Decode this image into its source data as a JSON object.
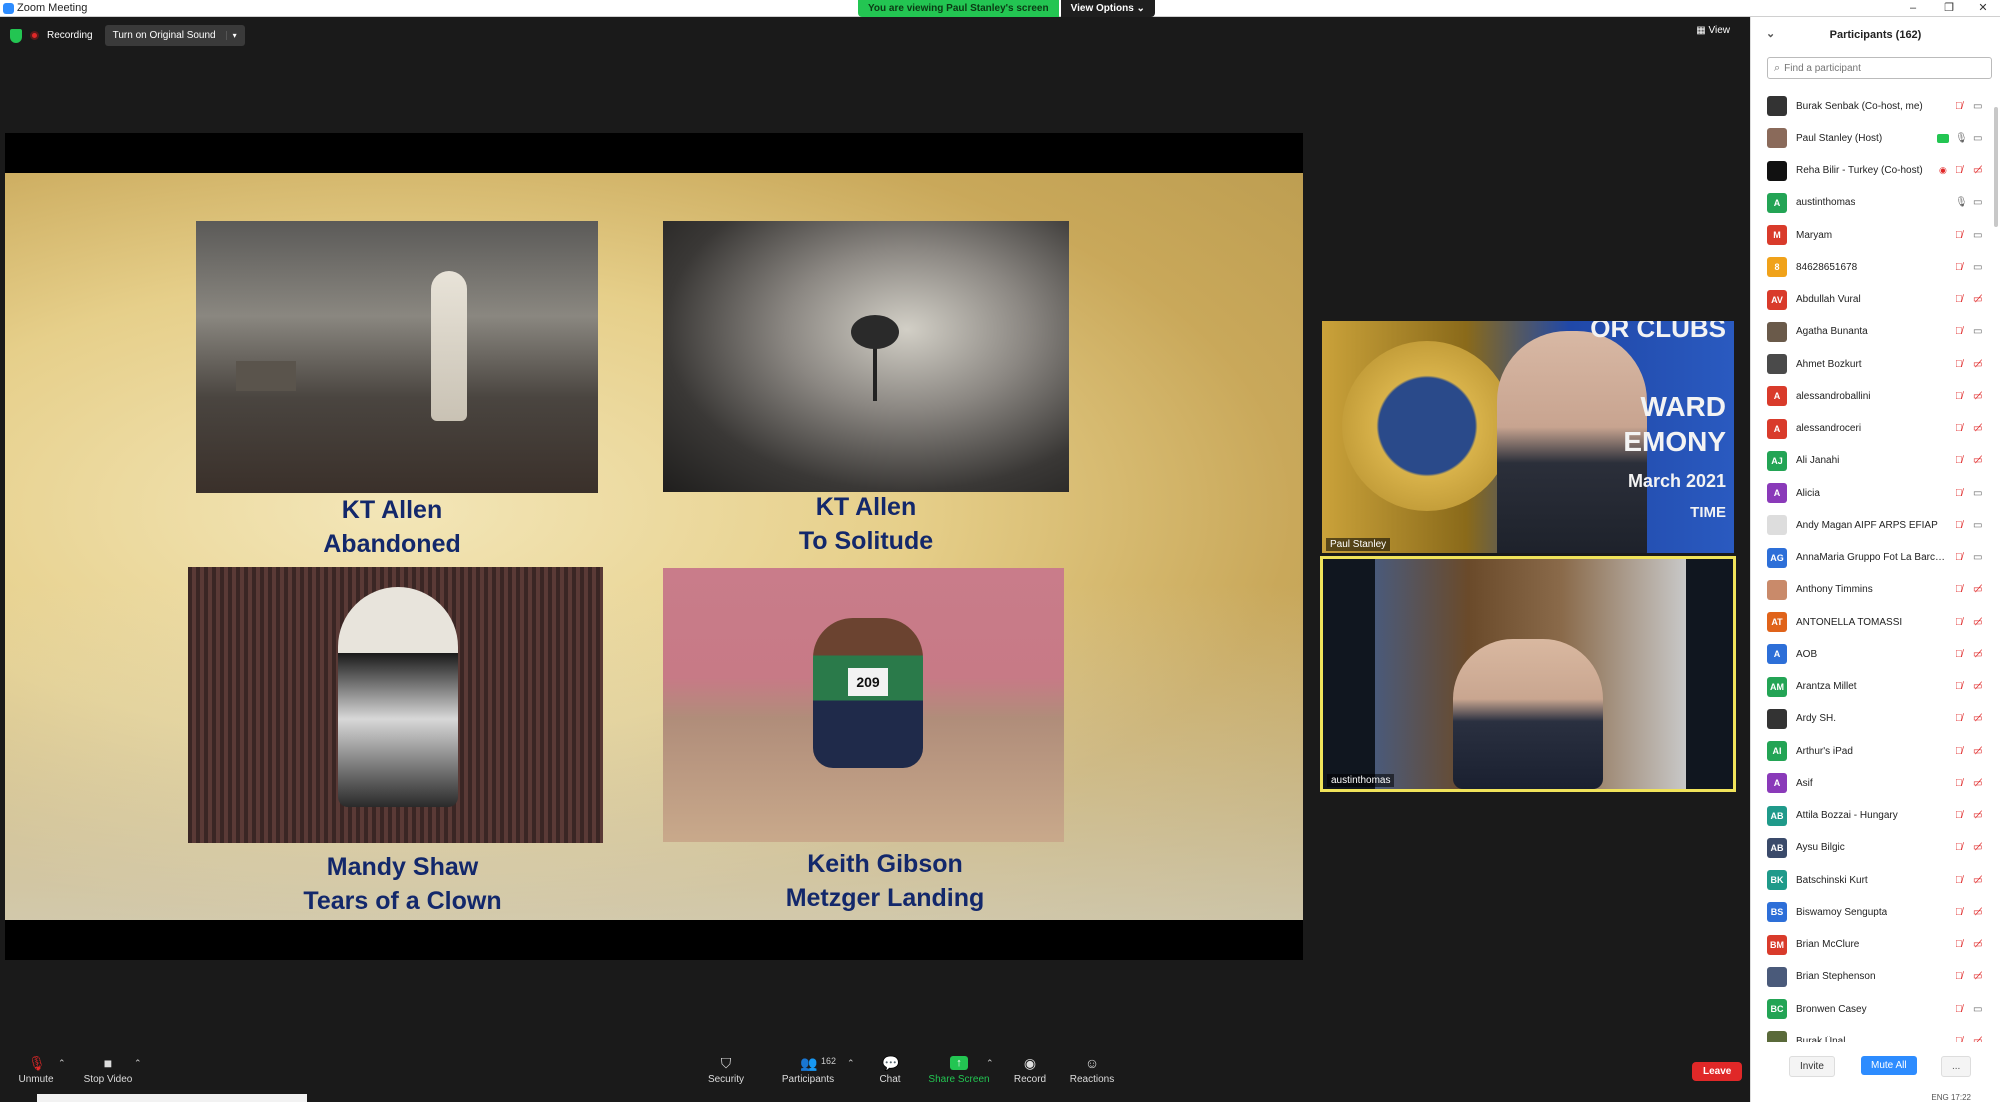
{
  "window": {
    "title": "Zoom Meeting",
    "minimize": "–",
    "restore": "❐",
    "close": "✕"
  },
  "banner": {
    "viewing": "You are viewing Paul Stanley's screen",
    "view_options": "View Options ⌄"
  },
  "topbar": {
    "recording": "Recording",
    "original_sound": "Turn on Original Sound",
    "caret": "▾",
    "view": "▦ View"
  },
  "slide": {
    "captions": [
      {
        "line1": "KT Allen",
        "line2": "Abandoned"
      },
      {
        "line1": "KT Allen",
        "line2": "To Solitude"
      },
      {
        "line1": "Mandy Shaw",
        "line2": "Tears of a Clown"
      },
      {
        "line1": "Keith Gibson",
        "line2": "Metzger Landing"
      }
    ],
    "bib": "209"
  },
  "videos": [
    {
      "name": "Paul Stanley",
      "bg_text": [
        "OR CLUBS",
        "WARD",
        "EMONY",
        "March 2021",
        "TIME"
      ]
    },
    {
      "name": "austinthomas"
    }
  ],
  "toolbar": {
    "unmute": "Unmute",
    "stop_video": "Stop Video",
    "security": "Security",
    "participants": "Participants",
    "participants_count": "162",
    "chat": "Chat",
    "share_screen": "Share Screen",
    "record": "Record",
    "reactions": "Reactions",
    "leave": "Leave"
  },
  "panel": {
    "title": "Participants (162)",
    "search_placeholder": "Find a participant",
    "invite": "Invite",
    "mute_all": "Mute All",
    "more": "...",
    "tray": "ENG 17:22"
  },
  "participants": [
    {
      "initials": "",
      "name": "Burak Senbak (Co-host, me)",
      "color": "#333333",
      "mic": "muted",
      "cam": "on"
    },
    {
      "initials": "",
      "name": "Paul Stanley (Host)",
      "color": "#8a6a5a",
      "mic": "on",
      "cam": "on",
      "sharing": true
    },
    {
      "initials": "",
      "name": "Reha Bilir - Turkey (Co-host)",
      "color": "#111111",
      "mic": "muted",
      "cam": "off",
      "recording": true
    },
    {
      "initials": "A",
      "name": "austinthomas",
      "color": "#23a455",
      "mic": "on",
      "cam": "on"
    },
    {
      "initials": "M",
      "name": "Maryam",
      "color": "#d93b2b",
      "mic": "muted",
      "cam": "on"
    },
    {
      "initials": "8",
      "name": "84628651678",
      "color": "#f0a21a",
      "mic": "muted",
      "cam": "on"
    },
    {
      "initials": "AV",
      "name": "Abdullah Vural",
      "color": "#d93b2b",
      "mic": "muted",
      "cam": "off"
    },
    {
      "initials": "",
      "name": "Agatha Bunanta",
      "color": "#6a5a4a",
      "mic": "muted",
      "cam": "on"
    },
    {
      "initials": "",
      "name": "Ahmet Bozkurt",
      "color": "#4a4a4a",
      "mic": "muted",
      "cam": "off"
    },
    {
      "initials": "A",
      "name": "alessandroballini",
      "color": "#d93b2b",
      "mic": "muted",
      "cam": "off"
    },
    {
      "initials": "A",
      "name": "alessandroceri",
      "color": "#d93b2b",
      "mic": "muted",
      "cam": "off"
    },
    {
      "initials": "AJ",
      "name": "Ali Janahi",
      "color": "#23a455",
      "mic": "muted",
      "cam": "off"
    },
    {
      "initials": "A",
      "name": "Alicia",
      "color": "#8a3ab9",
      "mic": "muted",
      "cam": "on"
    },
    {
      "initials": "",
      "name": "Andy Magan AIPF ARPS EFIAP",
      "color": "#dddddd",
      "mic": "muted",
      "cam": "on"
    },
    {
      "initials": "AG",
      "name": "AnnaMaria Gruppo Fot La Barch...",
      "color": "#2d6fd8",
      "mic": "muted",
      "cam": "on"
    },
    {
      "initials": "",
      "name": "Anthony Timmins",
      "color": "#c98a6a",
      "mic": "muted",
      "cam": "off"
    },
    {
      "initials": "AT",
      "name": "ANTONELLA TOMASSI",
      "color": "#e0631a",
      "mic": "muted",
      "cam": "off"
    },
    {
      "initials": "A",
      "name": "AOB",
      "color": "#2d6fd8",
      "mic": "muted",
      "cam": "off"
    },
    {
      "initials": "AM",
      "name": "Arantza Millet",
      "color": "#23a455",
      "mic": "muted",
      "cam": "off"
    },
    {
      "initials": "",
      "name": "Ardy SH.",
      "color": "#333333",
      "mic": "muted",
      "cam": "off"
    },
    {
      "initials": "AI",
      "name": "Arthur's iPad",
      "color": "#23a455",
      "mic": "muted",
      "cam": "off"
    },
    {
      "initials": "A",
      "name": "Asif",
      "color": "#8a3ab9",
      "mic": "muted",
      "cam": "off"
    },
    {
      "initials": "AB",
      "name": "Attila Bozzai - Hungary",
      "color": "#1f9a8a",
      "mic": "muted",
      "cam": "off"
    },
    {
      "initials": "AB",
      "name": "Aysu Bilgic",
      "color": "#3a4a6a",
      "mic": "muted",
      "cam": "off"
    },
    {
      "initials": "BK",
      "name": "Batschinski Kurt",
      "color": "#1f9a8a",
      "mic": "muted",
      "cam": "off"
    },
    {
      "initials": "BS",
      "name": "Biswamoy Sengupta",
      "color": "#2d6fd8",
      "mic": "muted",
      "cam": "off"
    },
    {
      "initials": "BM",
      "name": "Brian McClure",
      "color": "#d93b2b",
      "mic": "muted",
      "cam": "off"
    },
    {
      "initials": "",
      "name": "Brian Stephenson",
      "color": "#4a5a7a",
      "mic": "muted",
      "cam": "off"
    },
    {
      "initials": "BC",
      "name": "Bronwen Casey",
      "color": "#23a455",
      "mic": "muted",
      "cam": "on"
    },
    {
      "initials": "",
      "name": "Burak Ünal",
      "color": "#5a6a3a",
      "mic": "muted",
      "cam": "off"
    }
  ]
}
